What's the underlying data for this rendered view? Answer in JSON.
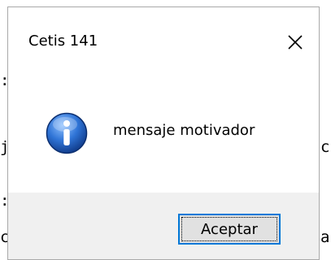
{
  "dialog": {
    "title": "Cetis 141",
    "close_icon": "close-icon",
    "icon": "information-icon",
    "message": "mensaje motivador",
    "ok_label": "Aceptar",
    "colors": {
      "footer_bg": "#f0f0f0",
      "button_border": "#0078d7",
      "icon_blue": "#1b5fbf"
    }
  },
  "background": {
    "fragments": [
      ":",
      "j",
      "c",
      ":",
      "c",
      "a"
    ]
  }
}
